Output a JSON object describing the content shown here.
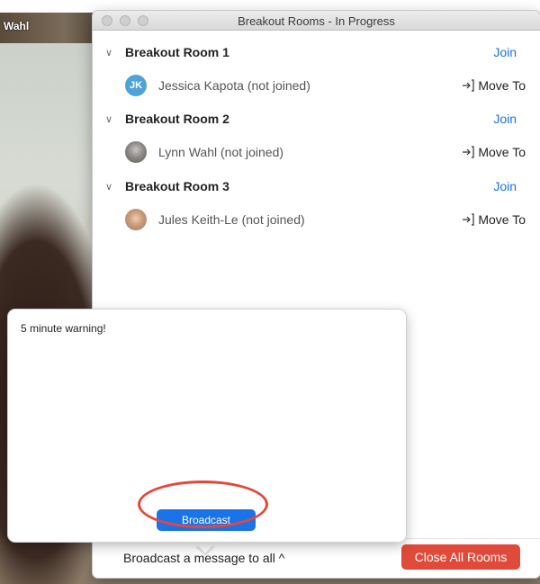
{
  "background": {
    "participant_name": "Wahl"
  },
  "window": {
    "title": "Breakout Rooms - In Progress",
    "rooms": [
      {
        "name": "Breakout Room 1",
        "join_label": "Join",
        "members": [
          {
            "initials": "JK",
            "name": "Jessica Kapota (not joined)",
            "move_label": "Move To",
            "avatar_color": "#4fa3d8"
          }
        ]
      },
      {
        "name": "Breakout Room 2",
        "join_label": "Join",
        "members": [
          {
            "initials": "",
            "name": "Lynn Wahl (not joined)",
            "move_label": "Move To",
            "avatar_color": "#8d8a86"
          }
        ]
      },
      {
        "name": "Breakout Room 3",
        "join_label": "Join",
        "members": [
          {
            "initials": "",
            "name": "Jules Keith-Le (not joined)",
            "move_label": "Move To",
            "avatar_color": "#c79a7a"
          }
        ]
      }
    ],
    "bottom": {
      "broadcast_label": "Broadcast a message to all ^",
      "close_all_label": "Close All Rooms"
    }
  },
  "popover": {
    "message": "5 minute warning!",
    "broadcast_button": "Broadcast"
  },
  "colors": {
    "accent": "#1a73e8",
    "danger": "#e04a3a",
    "highlight": "#e4473c"
  }
}
